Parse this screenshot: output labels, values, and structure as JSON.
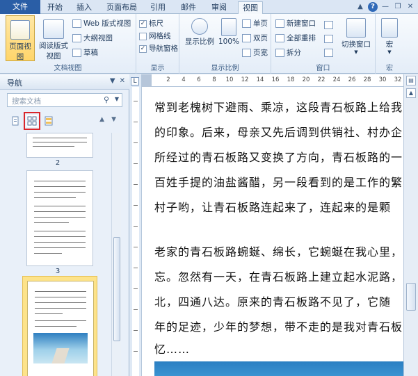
{
  "tabs": {
    "file": "文件",
    "items": [
      "开始",
      "插入",
      "页面布局",
      "引用",
      "邮件",
      "审阅",
      "视图"
    ],
    "active_index": 6
  },
  "ribbon": {
    "doc_views": {
      "label": "文档视图",
      "page_view": "页面视图",
      "reading_view_line1": "阅读版式",
      "reading_view_line2": "视图",
      "web_view": "Web 版式视图",
      "outline_view": "大纲视图",
      "draft_view": "草稿"
    },
    "show": {
      "label": "显示",
      "ruler": "标尺",
      "ruler_checked": true,
      "gridlines": "网格线",
      "gridlines_checked": false,
      "nav_pane": "导航窗格",
      "nav_pane_checked": true
    },
    "zoom": {
      "label": "显示比例",
      "zoom_btn": "显示比例",
      "hundred": "100%",
      "one_page": "单页",
      "two_pages": "双页",
      "page_width": "页宽"
    },
    "window": {
      "label": "窗口",
      "new_window": "新建窗口",
      "arrange_all": "全部重排",
      "split": "拆分",
      "switch_windows": "切换窗口"
    },
    "macros": {
      "label": "宏",
      "macro_btn": "宏"
    }
  },
  "nav": {
    "title": "导航",
    "search_placeholder": "搜索文档",
    "page_numbers": [
      "2",
      "3"
    ]
  },
  "ruler": {
    "ticks": [
      "2",
      "4",
      "6",
      "8",
      "10",
      "12",
      "14",
      "16",
      "18",
      "20",
      "22",
      "24",
      "26",
      "28",
      "30",
      "32"
    ]
  },
  "document": {
    "lines": [
      "常到老槐树下避雨、乘凉，这段青石板路上给我",
      "的印象。后来，母亲又先后调到供销社、村办企",
      "所经过的青石板路又变换了方向，青石板路的一",
      "百姓手提的油盐酱醋，另一段看到的是工作的繁",
      "村子哟，让青石板路连起来了，连起来的是颗",
      "",
      "老家的青石板路蜿蜒、绵长，它蜿蜒在我心里，",
      "忘。忽然有一天，在青石板路上建立起水泥路，",
      "北，四通八达。原来的青石板路不见了，它随",
      "年的足迹，少年的梦想，带不走的是我对青石板",
      "忆……"
    ]
  }
}
